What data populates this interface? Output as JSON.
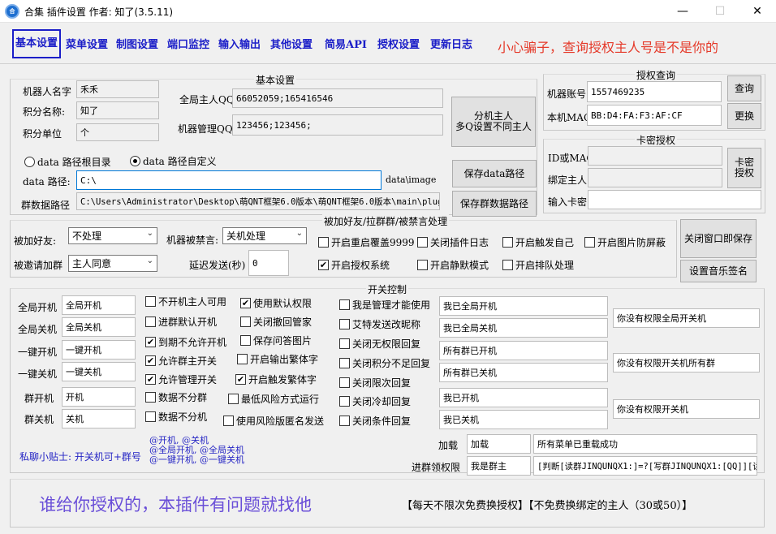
{
  "window": {
    "title": "合集 插件设置  作者: 知了(3.5.11)",
    "app_icon": "合"
  },
  "tabs": [
    "基本设置",
    "菜单设置",
    "制图设置",
    "端口监控",
    "输入输出",
    "其他设置",
    "简易API",
    "授权设置",
    "更新日志"
  ],
  "warning": "小心骗子，查询授权主人号是不是你的",
  "basic": {
    "group_title": "基本设置",
    "robot_name_label": "机器人名字",
    "robot_name": "禾禾",
    "points_name_label": "积分名称:",
    "points_name": "知了",
    "points_unit_label": "积分单位",
    "points_unit": "个",
    "global_owner_label": "全局主人QQ",
    "global_owner": "66052059;165416546",
    "robot_admin_label": "机器管理QQ",
    "robot_admin": "123456;123456;",
    "split_owner_btn": "分机主人\n多Q设置不同主人",
    "radio_root": "data 路径根目录",
    "radio_custom": "data 路径自定义",
    "data_path_label": "data 路径:",
    "data_path": "C:\\",
    "data_suffix": "data\\image",
    "save_data_btn": "保存data路径",
    "group_path_label": "群数据路径",
    "group_path": "C:\\Users\\Administrator\\Desktop\\萌QNT框架6.0版本\\萌QNT框架6.0版本\\main\\plug",
    "save_group_btn": "保存群数据路径"
  },
  "auth_query": {
    "group_title": "授权查询",
    "account_label": "机器账号",
    "account": "1557469235",
    "query_btn": "查询",
    "mac_label": "本机MAC",
    "mac": "BB:D4:FA:F3:AF:CF",
    "change_btn": "更换"
  },
  "card_auth": {
    "group_title": "卡密授权",
    "id_label": "ID或MAC",
    "owner_label": "绑定主人",
    "card_btn": "卡密\n授权",
    "input_label": "输入卡密"
  },
  "friend": {
    "group_title": "被加好友/拉群群/被禁言处理",
    "add_friend_label": "被加好友:",
    "add_friend_value": "不处理",
    "muted_label": "机器被禁言:",
    "muted_value": "关机处理",
    "invite_label": "被邀请加群",
    "invite_value": "主人同意",
    "delay_label": "延迟发送(秒)",
    "delay_value": "0",
    "checks": [
      {
        "label": "开启重启覆盖9999",
        "checked": false
      },
      {
        "label": "关闭插件日志",
        "checked": false
      },
      {
        "label": "开启触发自己",
        "checked": false
      },
      {
        "label": "开启图片防屏蔽",
        "checked": false
      },
      {
        "label": "开启授权系统",
        "checked": true
      },
      {
        "label": "开启静默模式",
        "checked": false
      },
      {
        "label": "开启排队处理",
        "checked": false
      }
    ],
    "close_save_btn": "关闭窗口即保存",
    "music_sign_btn": "设置音乐签名"
  },
  "switch": {
    "group_title": "开关控制",
    "rows": [
      {
        "label": "全局开机",
        "value": "全局开机"
      },
      {
        "label": "全局关机",
        "value": "全局关机"
      },
      {
        "label": "一键开机",
        "value": "一键开机"
      },
      {
        "label": "一键关机",
        "value": "一键关机"
      },
      {
        "label": "群开机",
        "value": "开机"
      },
      {
        "label": "群关机",
        "value": "关机"
      }
    ],
    "col1": [
      {
        "label": "不开机主人可用",
        "checked": false
      },
      {
        "label": "进群默认开机",
        "checked": false
      },
      {
        "label": "到期不允许开机",
        "checked": true
      },
      {
        "label": "允许群主开关",
        "checked": true
      },
      {
        "label": "允许管理开关",
        "checked": true
      },
      {
        "label": "数据不分群",
        "checked": false
      },
      {
        "label": "数据不分机",
        "checked": false
      }
    ],
    "col2": [
      {
        "label": "使用默认权限",
        "checked": true
      },
      {
        "label": "关闭撤回管家",
        "checked": false
      },
      {
        "label": "保存问答图片",
        "checked": false
      },
      {
        "label": "开启输出繁体字",
        "checked": false
      },
      {
        "label": "开启触发繁体字",
        "checked": true
      },
      {
        "label": "最低风险方式运行",
        "checked": false
      },
      {
        "label": "使用风险版匿名发送",
        "checked": false
      }
    ],
    "col3": [
      {
        "label": "我是管理才能使用",
        "checked": false
      },
      {
        "label": "艾特发送改昵称",
        "checked": false
      },
      {
        "label": "关闭无权限回复",
        "checked": false
      },
      {
        "label": "关闭积分不足回复",
        "checked": false
      },
      {
        "label": "关闭限次回复",
        "checked": false
      },
      {
        "label": "关闭冷却回复",
        "checked": false
      },
      {
        "label": "关闭条件回复",
        "checked": false
      }
    ],
    "replies": [
      "我已全局开机",
      "我已全局关机",
      "所有群已开机",
      "所有群已关机",
      "我已开机",
      "我已关机"
    ],
    "no_perm": [
      "你没有权限全局开关机",
      "你没有权限开关机所有群",
      "你没有权限开关机"
    ],
    "tip": "私聊小贴士: 开关机可+群号",
    "at_tips": [
      "@开机, @关机",
      "@全局开机, @全局关机",
      "@一键开机, @一键关机"
    ],
    "load_label": "加载",
    "load_value": "加载",
    "load_reply": "所有菜单已重载成功",
    "enter_label": "进群领权限",
    "enter_value": "我是群主",
    "enter_reply": "[判断[读群JINQUNQX1:]=?[写群JINQUNQX1:[QQ]][读"
  },
  "footer": {
    "slogan": "谁给你授权的，本插件有问题就找他",
    "notice": "【每天不限次免费换授权】【不免费换绑定的主人（30或50）】"
  }
}
